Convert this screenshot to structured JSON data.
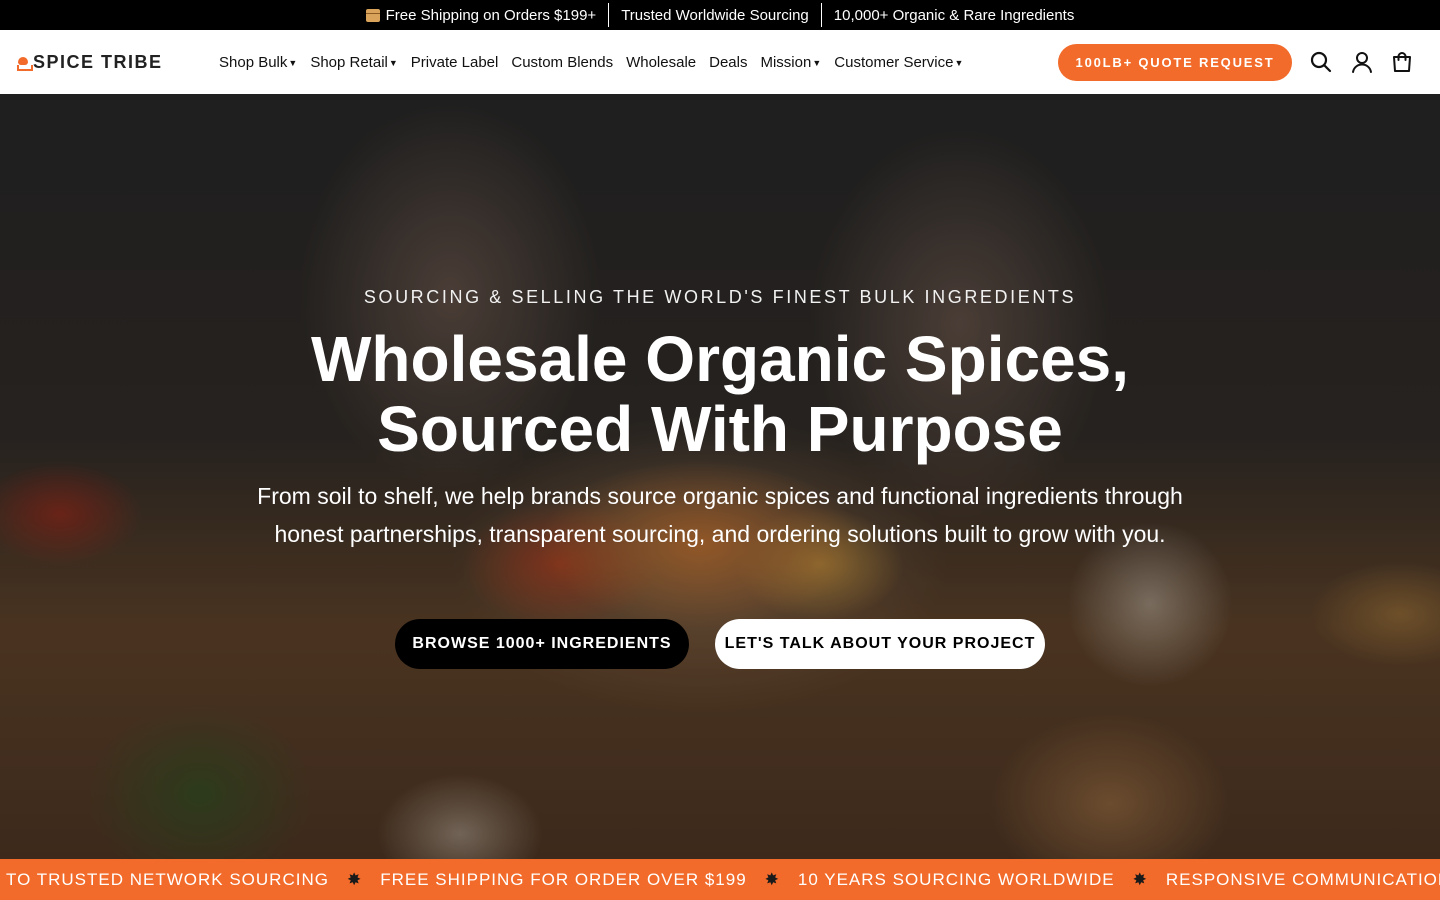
{
  "topbar": {
    "messages": [
      {
        "icon": "package-icon",
        "text": "Free Shipping on Orders $199+"
      },
      {
        "text": "Trusted Worldwide Sourcing"
      },
      {
        "text": "10,000+ Organic & Rare Ingredients"
      }
    ]
  },
  "header": {
    "logo_text": "SPICE TRIBE",
    "nav": [
      {
        "label": "Shop Bulk",
        "has_dropdown": true
      },
      {
        "label": "Shop Retail",
        "has_dropdown": true
      },
      {
        "label": "Private Label",
        "has_dropdown": false
      },
      {
        "label": "Custom Blends",
        "has_dropdown": false
      },
      {
        "label": "Wholesale",
        "has_dropdown": false
      },
      {
        "label": "Deals",
        "has_dropdown": false
      },
      {
        "label": "Mission",
        "has_dropdown": true
      },
      {
        "label": "Customer Service",
        "has_dropdown": true
      }
    ],
    "quote_button": "100LB+ QUOTE REQUEST",
    "icons": [
      "search-icon",
      "account-icon",
      "cart-icon"
    ]
  },
  "hero": {
    "eyebrow": "SOURCING & SELLING THE WORLD'S FINEST BULK INGREDIENTS",
    "title_line1": "Wholesale Organic Spices,",
    "title_line2": "Sourced With Purpose",
    "subtitle": "From soil to shelf, we help brands source organic spices and functional ingredients through honest partnerships, transparent sourcing, and ordering solutions built to grow with you.",
    "cta_primary": "BROWSE 1000+ INGREDIENTS",
    "cta_secondary": "LET'S TALK ABOUT YOUR PROJECT"
  },
  "marquee": {
    "items": [
      "TO TRUSTED NETWORK SOURCING",
      "FREE SHIPPING FOR ORDER OVER $199",
      "10 YEARS SOURCING WORLDWIDE",
      "RESPONSIVE COMMUNICATION AT YOUR SPEED"
    ],
    "separator": "✸"
  },
  "colors": {
    "accent": "#f26b2a",
    "topbar_bg": "#000000",
    "header_bg": "#ffffff"
  }
}
